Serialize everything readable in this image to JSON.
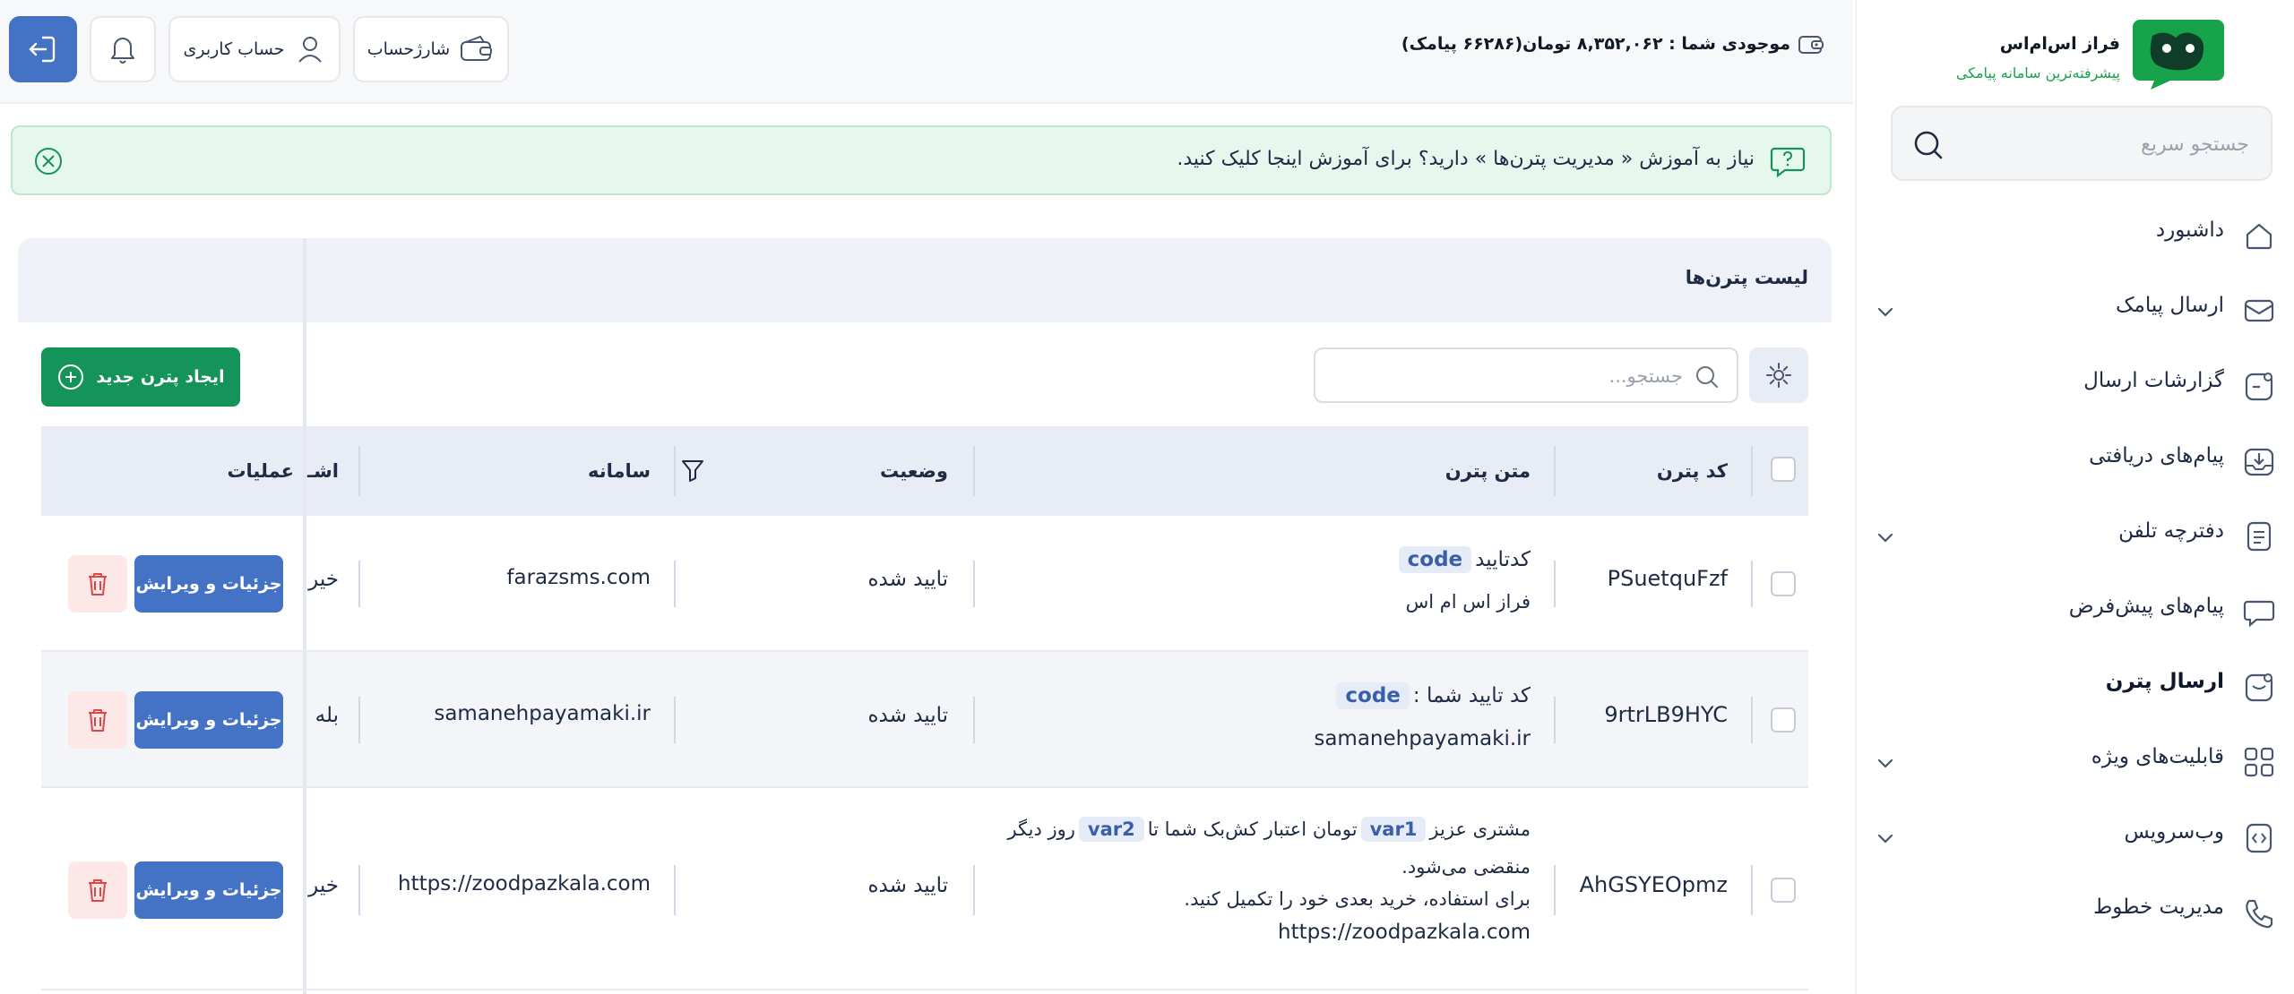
{
  "brand": {
    "name": "فراز اس‌ام‌اس",
    "tagline": "پیشرفته‌ترین سامانه پیامکی"
  },
  "sidebar": {
    "search_placeholder": "جستجو سریع",
    "items": [
      {
        "label": "داشبورد",
        "icon": "home-icon",
        "chevron": false
      },
      {
        "label": "ارسال پیامک",
        "icon": "message-send-icon",
        "chevron": true
      },
      {
        "label": "گزارشات ارسال",
        "icon": "report-icon",
        "chevron": false
      },
      {
        "label": "پیام‌های دریافتی",
        "icon": "inbox-icon",
        "chevron": false
      },
      {
        "label": "دفترچه تلفن",
        "icon": "phonebook-icon",
        "chevron": true
      },
      {
        "label": "پیام‌های پیش‌فرض",
        "icon": "chat-bubble-icon",
        "chevron": false
      },
      {
        "label": "ارسال پترن",
        "icon": "pattern-send-icon",
        "chevron": false,
        "active": true
      },
      {
        "label": "قابلیت‌های ویژه",
        "icon": "grid-icon",
        "chevron": true
      },
      {
        "label": "وب‌سرویس",
        "icon": "code-icon",
        "chevron": true
      },
      {
        "label": "مدیریت خطوط",
        "icon": "phone-icon",
        "chevron": false
      }
    ]
  },
  "header": {
    "balance": "موجودی شما : ۸,۳۵۲,۰۶۲ تومان(۶۶۲۸۶ پیامک)",
    "charge_label": "شارژحساب",
    "account_label": "حساب کاربری"
  },
  "help": {
    "text": "نیاز به آموزش « مدیریت پترن‌ها » دارید؟ برای آموزش اینجا کلیک کنید."
  },
  "card": {
    "title": "لیست پترن‌ها",
    "search_placeholder": "جستجو...",
    "new_button": "ایجاد پترن جدید"
  },
  "table": {
    "headers": {
      "code": "کد پترن",
      "text": "متن پترن",
      "status": "وضعیت",
      "system": "سامانه",
      "share": "اشـ",
      "ops": "عملیات"
    },
    "detail_label": "جزئیات و ویرایش",
    "rows": [
      {
        "code": "PSuetquFzf",
        "text_line1_pre": "کدتایید",
        "token1": "code",
        "text_line2": "فراز اس ام اس",
        "status": "تایید شده",
        "system": "farazsms.com",
        "share": "خیر"
      },
      {
        "code": "9rtrLB9HYC",
        "text_line1_pre": "کد تایید شما :",
        "token1": "code",
        "text_line2": "samanehpayamaki.ir",
        "status": "تایید شده",
        "system": "samanehpayamaki.ir",
        "share": "بله"
      },
      {
        "code": "AhGSYEOpmz",
        "text_line1_pre": "مشتری عزیز",
        "token1": "var1",
        "text_line1_mid": "تومان اعتبار کش‌بک شما تا",
        "token2": "var2",
        "text_line1_post": "روز دیگر",
        "text_line2": "منقضی می‌شود.",
        "text_line3": "برای استفاده، خرید بعدی خود را تکمیل کنید.",
        "text_line4": "https://zoodpazkala.com",
        "status": "تایید شده",
        "system": "https://zoodpazkala.com",
        "share": "خیر"
      }
    ]
  }
}
